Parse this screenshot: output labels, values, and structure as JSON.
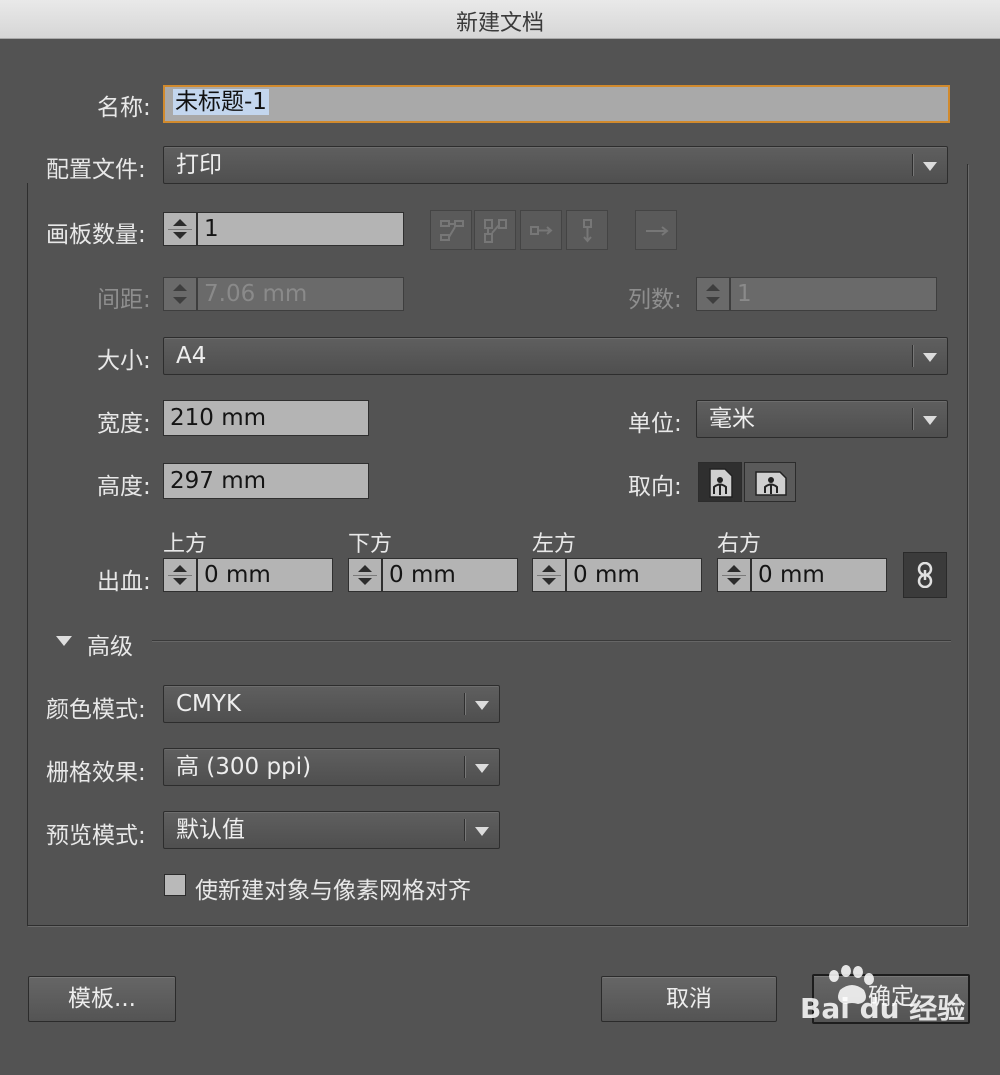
{
  "window": {
    "title": "新建文档"
  },
  "name": {
    "label": "名称:",
    "value": "未标题-1"
  },
  "profile": {
    "label": "配置文件:",
    "value": "打印"
  },
  "artboards": {
    "label": "画板数量:",
    "value": "1",
    "spacing_label": "间距:",
    "spacing_value": "7.06 mm",
    "columns_label": "列数:",
    "columns_value": "1"
  },
  "size": {
    "label": "大小:",
    "value": "A4"
  },
  "width": {
    "label": "宽度:",
    "value": "210 mm"
  },
  "height": {
    "label": "高度:",
    "value": "297 mm"
  },
  "units": {
    "label": "单位:",
    "value": "毫米"
  },
  "orientation": {
    "label": "取向:",
    "selected": "portrait"
  },
  "bleed": {
    "label": "出血:",
    "top_label": "上方",
    "top_value": "0 mm",
    "bottom_label": "下方",
    "bottom_value": "0 mm",
    "left_label": "左方",
    "left_value": "0 mm",
    "right_label": "右方",
    "right_value": "0 mm"
  },
  "advanced": {
    "label": "高级",
    "color_mode_label": "颜色模式:",
    "color_mode_value": "CMYK",
    "raster_label": "栅格效果:",
    "raster_value": "高 (300 ppi)",
    "preview_label": "预览模式:",
    "preview_value": "默认值",
    "align_pixel_grid_label": "使新建对象与像素网格对齐",
    "align_pixel_grid_checked": false
  },
  "buttons": {
    "templates": "模板...",
    "cancel": "取消",
    "ok": "确定"
  },
  "watermark": {
    "text": "Bai du 经验"
  },
  "colors": {
    "background": "#535353",
    "focus_border": "#d18a2d",
    "field": "#b4b4b4"
  }
}
